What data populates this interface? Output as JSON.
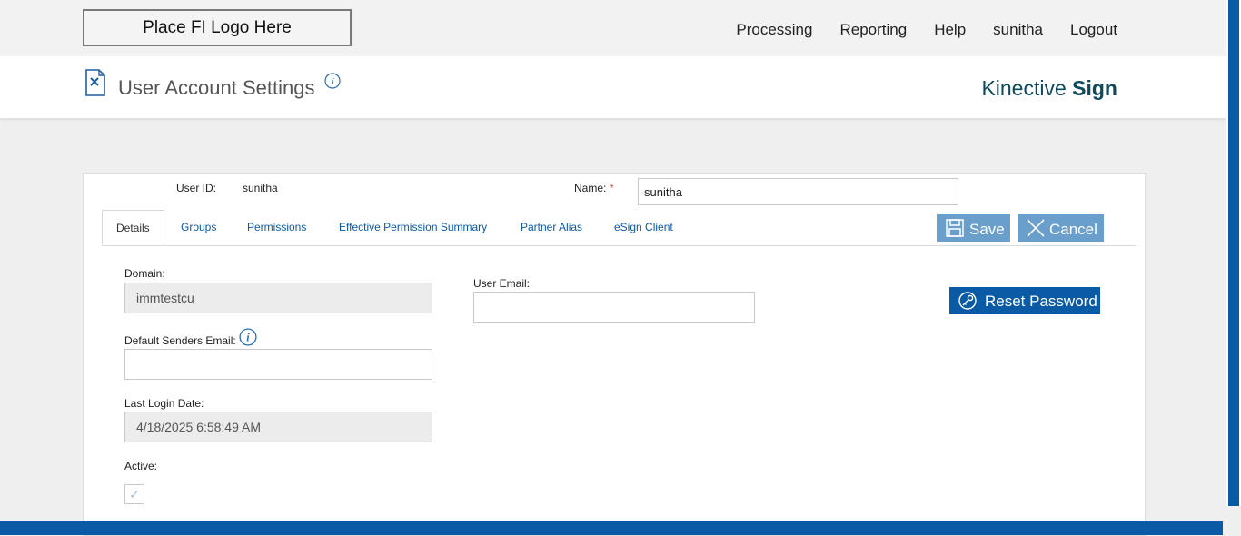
{
  "logo": {
    "text": "Place FI Logo Here"
  },
  "nav": {
    "processing": "Processing",
    "reporting": "Reporting",
    "help": "Help",
    "user": "sunitha",
    "logout": "Logout"
  },
  "header": {
    "title": "User Account Settings",
    "brand_light": "Kinective",
    "brand_bold": "Sign"
  },
  "form": {
    "user_id_label": "User ID:",
    "user_id_value": "sunitha",
    "name_label": "Name:",
    "name_required": "*",
    "name_value": "sunitha",
    "domain_label": "Domain:",
    "domain_value": "immtestcu",
    "default_senders_email_label": "Default Senders Email:",
    "default_senders_email_value": "",
    "last_login_label": "Last Login Date:",
    "last_login_value": "4/18/2025 6:58:49 AM",
    "active_label": "Active:",
    "active_checked": true,
    "user_email_label": "User Email:",
    "user_email_value": ""
  },
  "tabs": [
    "Details",
    "Groups",
    "Permissions",
    "Effective Permission Summary",
    "Partner Alias",
    "eSign Client"
  ],
  "buttons": {
    "save": "Save",
    "cancel": "Cancel",
    "reset_password": "Reset Password"
  },
  "colors": {
    "primary": "#0a5aa6",
    "button_light": "#6a9fcc",
    "brand": "#0d4a5c",
    "required": "#d9302c"
  }
}
